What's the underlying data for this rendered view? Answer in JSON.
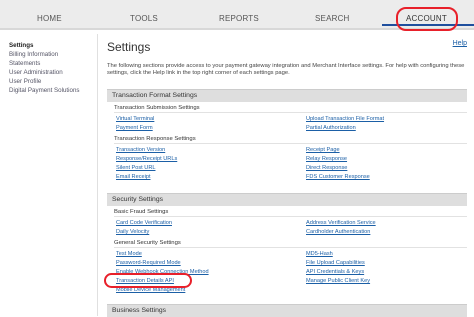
{
  "nav": {
    "tabs": [
      {
        "label": "HOME"
      },
      {
        "label": "TOOLS"
      },
      {
        "label": "REPORTS"
      },
      {
        "label": "SEARCH"
      },
      {
        "label": "ACCOUNT"
      }
    ]
  },
  "sidebar": {
    "items": [
      {
        "label": "Settings"
      },
      {
        "label": "Billing Information"
      },
      {
        "label": "Statements"
      },
      {
        "label": "User Administration"
      },
      {
        "label": "User Profile"
      },
      {
        "label": "Digital Payment Solutions"
      }
    ]
  },
  "main": {
    "title": "Settings",
    "help": "Help",
    "intro": "The following sections provide access to your payment gateway integration and Merchant Interface settings. For help with configuring these settings, click the Help link in the top right corner of each settings page.",
    "sections": [
      {
        "title": "Transaction Format Settings",
        "groups": [
          {
            "title": "Transaction Submission Settings",
            "left": [
              "Virtual Terminal",
              "Payment Form"
            ],
            "right": [
              "Upload Transaction File Format",
              "Partial Authorization"
            ]
          },
          {
            "title": "Transaction Response Settings",
            "left": [
              "Transaction Version",
              "Response/Receipt URLs",
              "Silent Post URL",
              "Email Receipt"
            ],
            "right": [
              "Receipt Page",
              "Relay Response",
              "Direct Response",
              "FDS Customer Response"
            ]
          }
        ]
      },
      {
        "title": "Security Settings",
        "groups": [
          {
            "title": "Basic Fraud Settings",
            "left": [
              "Card Code Verification",
              "Daily Velocity"
            ],
            "right": [
              "Address Verification Service",
              "Cardholder Authentication"
            ]
          },
          {
            "title": "General Security Settings",
            "left": [
              "Test Mode",
              "Password-Required Mode",
              "Enable Webhook Connection Method",
              "Transaction Details API",
              "Mobile Device Management"
            ],
            "right": [
              "MD5-Hash",
              "File Upload Capabilities",
              "API Credentials & Keys",
              "Manage Public Client Key"
            ]
          }
        ]
      },
      {
        "title": "Business Settings"
      }
    ]
  },
  "colors": {
    "link": "#1b5fa6",
    "highlight": "#e8202a",
    "active_tab": "#1f4f9e"
  }
}
